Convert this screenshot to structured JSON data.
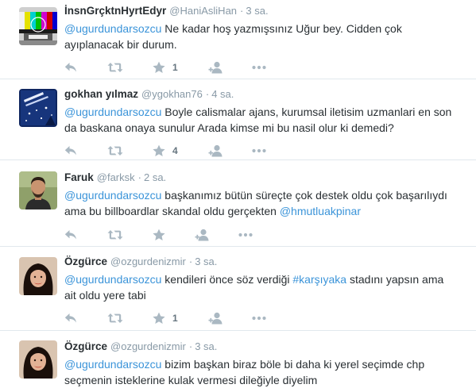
{
  "tweets": [
    {
      "fullname": "İnsnGrçktnHyrtEdyr",
      "username": "@HaniAsliHan",
      "time": "3 sa.",
      "avatar": "test-pattern",
      "line1": {
        "mention": "@ugurdundarsozcu",
        "rest": " Ne kadar hoş yazmışsınız Uğur bey. Cidden çok"
      },
      "line2": "ayıplanacak bir durum.",
      "favorites": "1"
    },
    {
      "fullname": "gokhan yılmaz",
      "username": "@ygokhan76",
      "time": "4 sa.",
      "avatar": "book-cover",
      "line1": {
        "mention": "@ugurdundarsozcu",
        "rest": " Boyle calismalar ajans, kurumsal iletisim uzmanlari en son"
      },
      "line2": "da baskana onaya sunulur Arada kimse mi bu nasil olur ki demedi?",
      "favorites": "4"
    },
    {
      "fullname": "Faruk",
      "username": "@farksk",
      "time": "2 sa.",
      "avatar": "man-portrait",
      "line1": {
        "mention": "@ugurdundarsozcu",
        "rest": " başkanımız bütün süreçte çok destek oldu çok başarılıydı"
      },
      "line2a": "ama bu billboardlar skandal oldu gerçekten ",
      "line2_mention": "@hmutluakpinar",
      "favorites": ""
    },
    {
      "fullname": "Özgürce",
      "username": "@ozgurdenizmir",
      "time": "3 sa.",
      "avatar": "woman-portrait",
      "line1": {
        "mention": "@ugurdundarsozcu",
        "rest": " kendileri önce söz verdiği "
      },
      "line1_hashtag": "#karşıyaka",
      "line1_tail": " stadını yapsın ama",
      "line2": "ait oldu yere tabi",
      "favorites": "1"
    },
    {
      "fullname": "Özgürce",
      "username": "@ozgurdenizmir",
      "time": "3 sa.",
      "avatar": "woman-portrait",
      "line1": {
        "mention": "@ugurdundarsozcu",
        "rest": " bizim başkan biraz böle bi daha ki yerel seçimde chp"
      },
      "line2": "seçmenin isteklerine kulak vermesi dileğiyle diyelim"
    }
  ],
  "colors": {
    "link": "#3b94d9",
    "muted": "#8899a6",
    "icon": "#aab8c2",
    "divider": "#e1e8ed"
  }
}
